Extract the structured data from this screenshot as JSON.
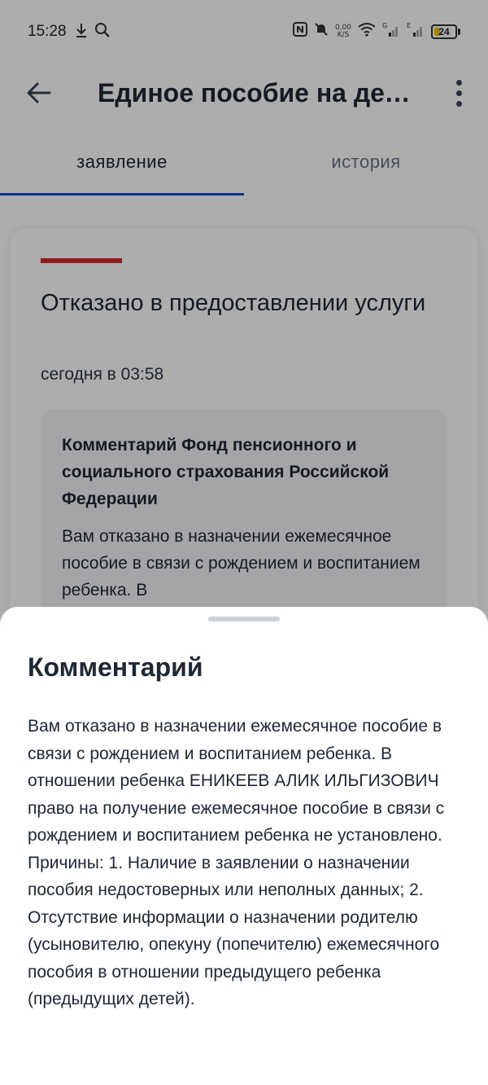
{
  "status_bar": {
    "time": "15:28",
    "net_speed_top": "0,00",
    "net_speed_bottom": "K/S",
    "battery_level": "24",
    "icons": [
      "download-icon",
      "search-icon",
      "nfc-icon",
      "mute-icon",
      "wifi-icon",
      "signal-g-icon",
      "signal-e-icon",
      "battery-icon"
    ]
  },
  "app_bar": {
    "title": "Единое пособие на детей"
  },
  "tabs": [
    {
      "label": "заявление",
      "active": true
    },
    {
      "label": "история",
      "active": false
    }
  ],
  "card": {
    "status_title": "Отказано в предоставлении услуги",
    "status_color": "#d3282b",
    "date": "сегодня в 03:58",
    "comment_heading": "Комментарий Фонд пенсионного и социального страхования Российской Федерации",
    "comment_preview": "Вам отказано в назначении ежемесячное пособие в связи с рождением и воспитанием ребенка. В"
  },
  "sheet": {
    "title": "Комментарий",
    "text": "Вам отказано в назначении ежемесячное пособие в связи с рождением и воспитанием ребенка. В отношении ребенка ЕНИКЕЕВ АЛИК ИЛЬГИЗОВИЧ право на получение ежемесячное пособие в связи с рождением и воспитанием ребенка не установлено. Причины: 1. Наличие в заявлении о назначении пособия недостоверных или неполных данных; 2. Отсутствие информации о назначении родителю (усыновителю, опекуну (попечителю) ежемесячного пособия в отношении предыдущего ребенка (предыдущих детей)."
  },
  "colors": {
    "accent": "#0d4cd3",
    "text": "#1f2733"
  }
}
